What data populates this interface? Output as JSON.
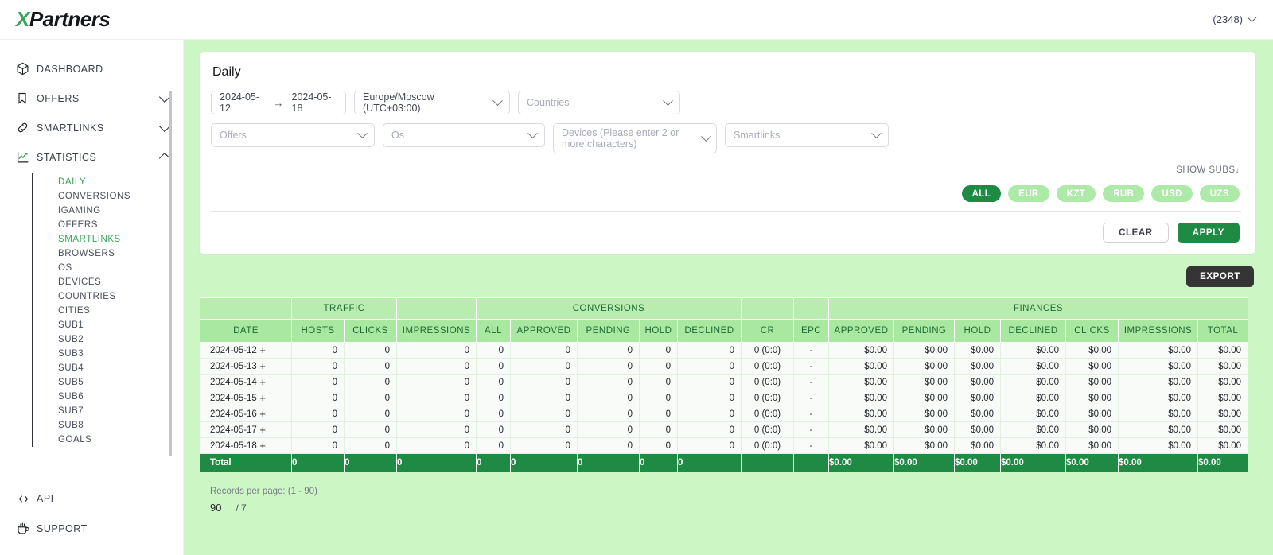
{
  "brand": {
    "x": "X",
    "rest": "Partners"
  },
  "header": {
    "account": "(2348)",
    "caret_icon": "chevron-down-icon"
  },
  "sidebar": {
    "items": [
      {
        "label": "DASHBOARD",
        "icon": "cube-icon",
        "caret": "",
        "active": false
      },
      {
        "label": "OFFERS",
        "icon": "bookmark-icon",
        "caret": "down",
        "active": false
      },
      {
        "label": "SMARTLINKS",
        "icon": "link-icon",
        "caret": "down",
        "active": false
      },
      {
        "label": "STATISTICS",
        "icon": "chart-line-icon",
        "caret": "up",
        "active": false
      }
    ],
    "sub_items": [
      {
        "label": "DAILY",
        "active": true
      },
      {
        "label": "CONVERSIONS",
        "active": false
      },
      {
        "label": "IGAMING",
        "active": false
      },
      {
        "label": "OFFERS",
        "active": false
      },
      {
        "label": "SMARTLINKS",
        "active": true
      },
      {
        "label": "BROWSERS",
        "active": false
      },
      {
        "label": "OS",
        "active": false
      },
      {
        "label": "DEVICES",
        "active": false
      },
      {
        "label": "COUNTRIES",
        "active": false
      },
      {
        "label": "CITIES",
        "active": false
      },
      {
        "label": "SUB1",
        "active": false
      },
      {
        "label": "SUB2",
        "active": false
      },
      {
        "label": "SUB3",
        "active": false
      },
      {
        "label": "SUB4",
        "active": false
      },
      {
        "label": "SUB5",
        "active": false
      },
      {
        "label": "SUB6",
        "active": false
      },
      {
        "label": "SUB7",
        "active": false
      },
      {
        "label": "SUB8",
        "active": false
      },
      {
        "label": "GOALS",
        "active": false
      }
    ],
    "bottom_items": [
      {
        "label": "API",
        "icon": "code-brackets-icon"
      },
      {
        "label": "SUPPORT",
        "icon": "coffee-cup-icon"
      }
    ]
  },
  "filters": {
    "title": "Daily",
    "date_from": "2024-05-12",
    "date_to": "2024-05-18",
    "date_arrow": "→",
    "timezone": "Europe/Moscow (UTC+03:00)",
    "countries_placeholder": "Countries",
    "offers_placeholder": "Offers",
    "os_placeholder": "Os",
    "devices_placeholder": "Devices (Please enter 2 or more characters)",
    "smartlinks_placeholder": "Smartlinks",
    "show_subs": "SHOW SUBS",
    "show_subs_arrow": "↓",
    "currencies": [
      {
        "label": "ALL",
        "selected": true
      },
      {
        "label": "EUR",
        "selected": false
      },
      {
        "label": "KZT",
        "selected": false
      },
      {
        "label": "RUB",
        "selected": false
      },
      {
        "label": "USD",
        "selected": false
      },
      {
        "label": "UZS",
        "selected": false
      }
    ],
    "clear_label": "CLEAR",
    "apply_label": "APPLY"
  },
  "export_label": "EXPORT",
  "table": {
    "group_headers": [
      {
        "label": "",
        "span": 1
      },
      {
        "label": "TRAFFIC",
        "span": 2
      },
      {
        "label": "",
        "span": 1
      },
      {
        "label": "CONVERSIONS",
        "span": 5
      },
      {
        "label": "",
        "span": 1
      },
      {
        "label": "",
        "span": 1
      },
      {
        "label": "FINANCES",
        "span": 7
      }
    ],
    "columns": [
      "DATE",
      "HOSTS",
      "CLICKS",
      "IMPRESSIONS",
      "ALL",
      "APPROVED",
      "PENDING",
      "HOLD",
      "DECLINED",
      "CR",
      "EPC",
      "APPROVED",
      "PENDING",
      "HOLD",
      "DECLINED",
      "CLICKS",
      "IMPRESSIONS",
      "TOTAL"
    ],
    "expand_icon": "plus-icon",
    "rows": [
      [
        "2024-05-12",
        "0",
        "0",
        "0",
        "0",
        "0",
        "0",
        "0",
        "0",
        "0 (0:0)",
        "-",
        "$0.00",
        "$0.00",
        "$0.00",
        "$0.00",
        "$0.00",
        "$0.00",
        "$0.00"
      ],
      [
        "2024-05-13",
        "0",
        "0",
        "0",
        "0",
        "0",
        "0",
        "0",
        "0",
        "0 (0:0)",
        "-",
        "$0.00",
        "$0.00",
        "$0.00",
        "$0.00",
        "$0.00",
        "$0.00",
        "$0.00"
      ],
      [
        "2024-05-14",
        "0",
        "0",
        "0",
        "0",
        "0",
        "0",
        "0",
        "0",
        "0 (0:0)",
        "-",
        "$0.00",
        "$0.00",
        "$0.00",
        "$0.00",
        "$0.00",
        "$0.00",
        "$0.00"
      ],
      [
        "2024-05-15",
        "0",
        "0",
        "0",
        "0",
        "0",
        "0",
        "0",
        "0",
        "0 (0:0)",
        "-",
        "$0.00",
        "$0.00",
        "$0.00",
        "$0.00",
        "$0.00",
        "$0.00",
        "$0.00"
      ],
      [
        "2024-05-16",
        "0",
        "0",
        "0",
        "0",
        "0",
        "0",
        "0",
        "0",
        "0 (0:0)",
        "-",
        "$0.00",
        "$0.00",
        "$0.00",
        "$0.00",
        "$0.00",
        "$0.00",
        "$0.00"
      ],
      [
        "2024-05-17",
        "0",
        "0",
        "0",
        "0",
        "0",
        "0",
        "0",
        "0",
        "0 (0:0)",
        "-",
        "$0.00",
        "$0.00",
        "$0.00",
        "$0.00",
        "$0.00",
        "$0.00",
        "$0.00"
      ],
      [
        "2024-05-18",
        "0",
        "0",
        "0",
        "0",
        "0",
        "0",
        "0",
        "0",
        "0 (0:0)",
        "-",
        "$0.00",
        "$0.00",
        "$0.00",
        "$0.00",
        "$0.00",
        "$0.00",
        "$0.00"
      ]
    ],
    "total_row": [
      "Total",
      "0",
      "0",
      "0",
      "0",
      "0",
      "0",
      "0",
      "0",
      "",
      "",
      "$0.00",
      "$0.00",
      "$0.00",
      "$0.00",
      "$0.00",
      "$0.00",
      "$0.00"
    ]
  },
  "pager": {
    "records_label": "Records per page: (1 - 90)",
    "per_page": "90",
    "total_pages": "/ 7"
  },
  "colors": {
    "brand_green": "#3aa35c",
    "dark_green": "#1f8a44",
    "page_bg": "#ccf7c4",
    "chip_idle": "#aeeaa7",
    "header_cell": "#a9e8a1",
    "group_cell": "#b9edb0",
    "export_dark": "#353535"
  }
}
